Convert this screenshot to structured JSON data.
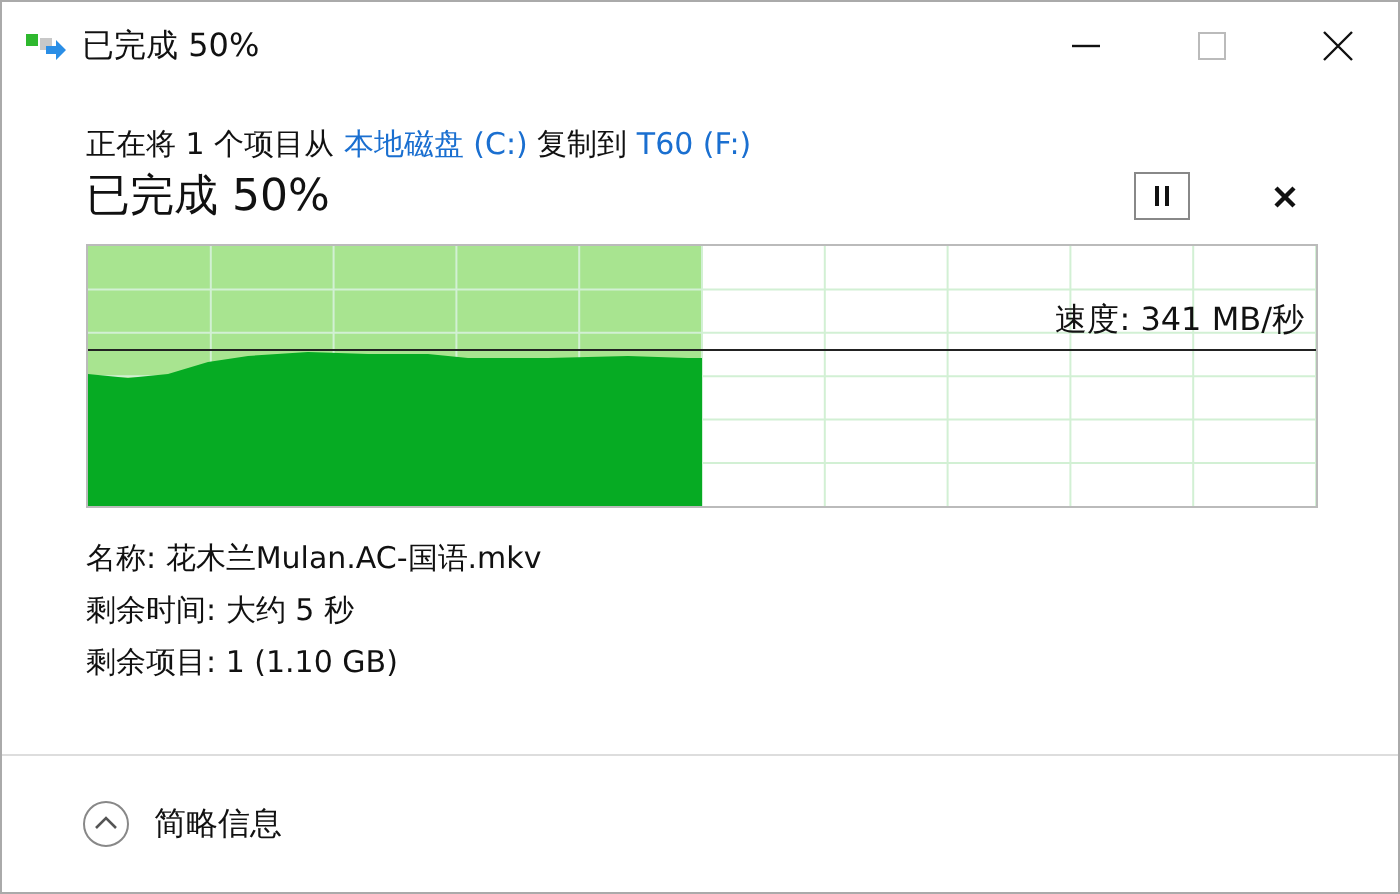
{
  "window": {
    "title": "已完成 50%"
  },
  "description": [
    {
      "kind": "text",
      "text": "正在将 1 个项目从 "
    },
    {
      "kind": "link",
      "text": "本地磁盘 (C:)"
    },
    {
      "kind": "text",
      "text": " 复制到 "
    },
    {
      "kind": "link",
      "text": "T60 (F:)"
    }
  ],
  "progress": {
    "heading": "已完成 50%",
    "level": 0.5,
    "speed": "速度: 341 MB/秒"
  },
  "details": [
    "名称: 花木兰Mulan.AC-国语.mkv",
    "剩余时间: 大约 5 秒",
    "剩余项目: 1 (1.10 GB)"
  ],
  "footer": {
    "toggle": "简略信息"
  }
}
